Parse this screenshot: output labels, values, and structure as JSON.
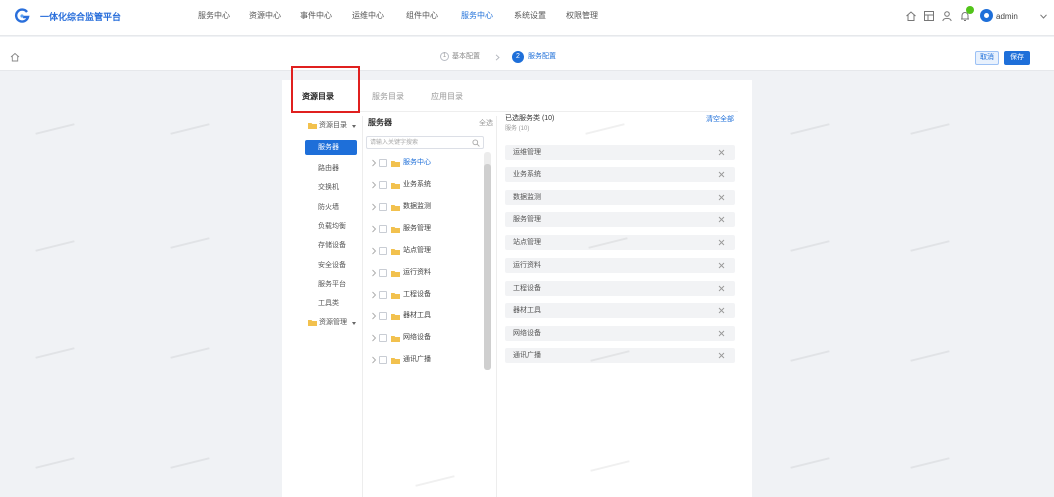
{
  "app": {
    "title": "一体化综合监管平台"
  },
  "nav": {
    "items": [
      "服务中心",
      "资源中心",
      "事件中心",
      "运维中心",
      "组件中心",
      "服务中心",
      "系统设置",
      "权限管理"
    ],
    "active_index": 5
  },
  "header_icons": [
    "home-icon",
    "grid-icon",
    "user-icon",
    "bell-icon"
  ],
  "user": {
    "name": "admin"
  },
  "steps": [
    {
      "number": "1",
      "label": "基本配置"
    },
    {
      "number": "2",
      "label": "服务配置"
    }
  ],
  "actions": {
    "cancel": "取消",
    "save": "保存"
  },
  "tabs": [
    "资源目录",
    "服务目录",
    "应用目录"
  ],
  "left_tree": {
    "group1": "资源目录",
    "selected": "服务器",
    "items": [
      "路由器",
      "交换机",
      "防火墙",
      "负载均衡",
      "存储设备",
      "安全设备",
      "服务平台",
      "工具类"
    ],
    "group2": "资源管理"
  },
  "middle": {
    "title": "服务器",
    "select_all": "全选",
    "search_placeholder": "请输入关键字搜索",
    "items": [
      "服务中心",
      "业务系统",
      "数据监测",
      "服务管理",
      "站点管理",
      "运行资料",
      "工程设备",
      "器材工具",
      "网络设备",
      "通讯广播"
    ]
  },
  "selected_panel": {
    "title": "已选服务类 (10)",
    "subtitle": "服务 (10)",
    "clear_all": "清空全部",
    "items": [
      "运维管理",
      "业务系统",
      "数据监测",
      "服务管理",
      "站点管理",
      "运行资料",
      "工程设备",
      "器材工具",
      "网络设备",
      "通讯广播"
    ]
  },
  "colors": {
    "primary": "#1e6fd9",
    "annotation": "#e0201f",
    "folder": "#f2c14e",
    "badge": "#52c41a",
    "background": "#f0f2f5"
  }
}
